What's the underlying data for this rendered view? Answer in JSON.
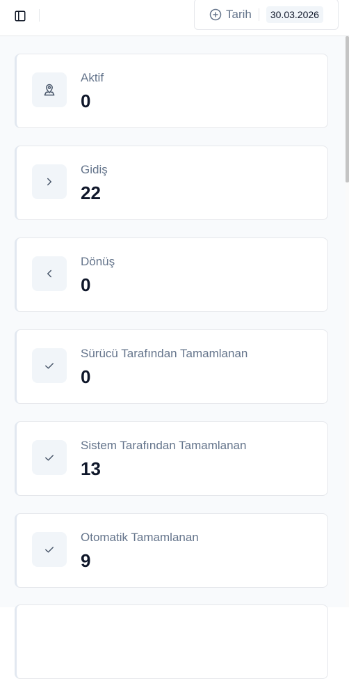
{
  "header": {
    "sidebar_toggle_icon": "sidebar-panel-icon",
    "date_filter": {
      "add_label": "Tarih",
      "add_icon": "plus-circle-icon",
      "selected_date": "30.03.2026"
    }
  },
  "cards": [
    {
      "label": "Aktif",
      "value": "0",
      "icon": "map-pin-icon"
    },
    {
      "label": "Gidiş",
      "value": "22",
      "icon": "chevron-right-icon"
    },
    {
      "label": "Dönüş",
      "value": "0",
      "icon": "chevron-left-icon"
    },
    {
      "label": "Sürücü Tarafından Tamamlanan",
      "value": "0",
      "icon": "check-icon"
    },
    {
      "label": "Sistem Tarafından Tamamlanan",
      "value": "13",
      "icon": "check-icon"
    },
    {
      "label": "Otomatik Tamamlanan",
      "value": "9",
      "icon": "check-icon"
    }
  ],
  "colors": {
    "accent_text": "#0f172a",
    "muted_text": "#64748b",
    "icon_bg": "#f1f5f9",
    "border": "#e5e7eb"
  }
}
